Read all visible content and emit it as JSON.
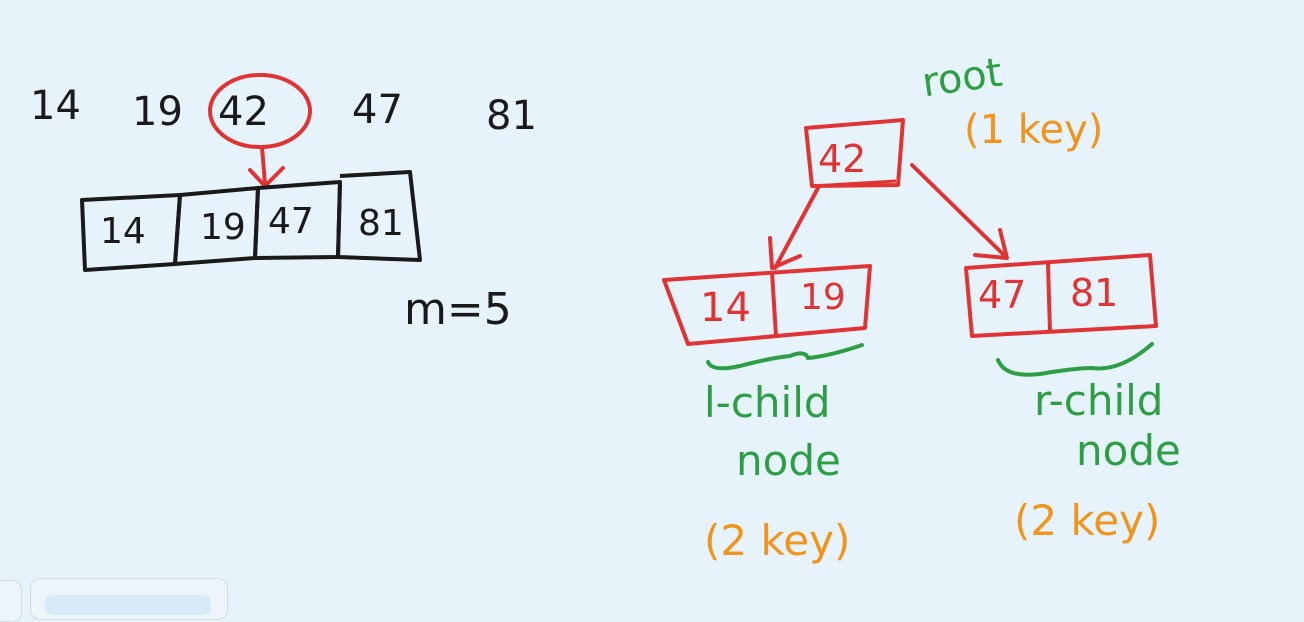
{
  "sequence": [
    "14",
    "19",
    "42",
    "47",
    "81"
  ],
  "array_cells": [
    "14",
    "19",
    "47",
    "81"
  ],
  "order": "m=5",
  "root": {
    "key": "42",
    "label": "root",
    "count": "(1 key)"
  },
  "left_child": {
    "keys": [
      "14",
      "19"
    ],
    "label_line1": "l-child",
    "label_line2": "node",
    "count": "(2 key)"
  },
  "right_child": {
    "keys": [
      "47",
      "81"
    ],
    "label_line1": "r-child",
    "label_line2": "node",
    "count": "(2 key)"
  },
  "colors": {
    "ink": "#1a1a1a",
    "highlight": "#e03434",
    "label": "#2e9e44",
    "note": "#f0941c",
    "background": "#e6f3fb"
  }
}
